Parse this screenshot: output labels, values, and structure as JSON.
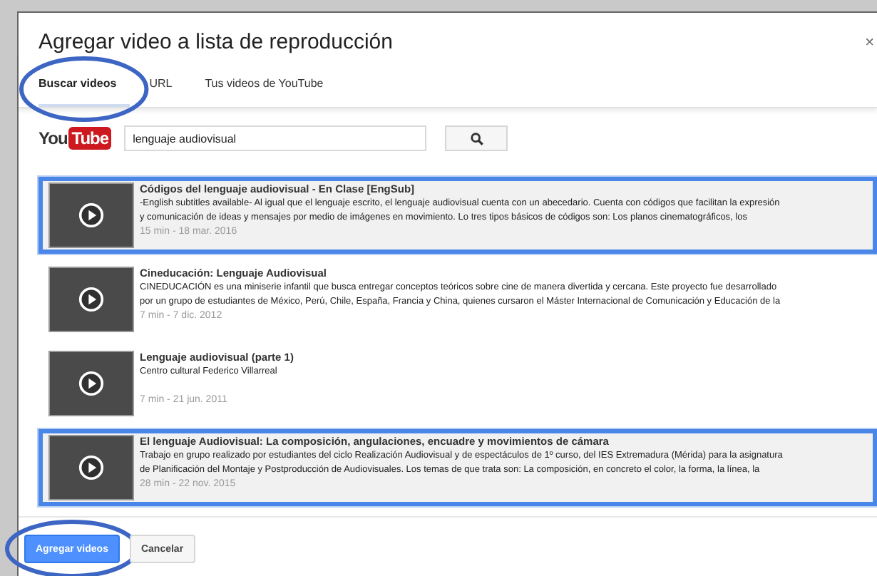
{
  "dialog": {
    "title": "Agregar video a lista de reproducción",
    "close": "×"
  },
  "tabs": [
    {
      "label": "Buscar videos",
      "selected": true,
      "circled": true
    },
    {
      "label": "URL",
      "selected": false,
      "circled": false
    },
    {
      "label": "Tus videos de YouTube",
      "selected": false,
      "circled": false
    }
  ],
  "search": {
    "logo_left": "You",
    "logo_right": "Tube",
    "value": "lenguaje audiovisual"
  },
  "results": [
    {
      "title": "Códigos del lenguaje audiovisual - En Clase [EngSub]",
      "description_lines": [
        "-English subtitles available- Al igual que el lenguaje escrito, el lenguaje audiovisual cuenta con un abecedario. Cuenta con códigos que facilitan la expresión",
        "y comunicación de ideas y mensajes por medio de imágenes en movimiento. Lo tres tipos básicos de códigos son: Los planos cinematográficos, los"
      ],
      "meta": "15 min - 18 mar. 2016",
      "selected": true
    },
    {
      "title": "Cineducación: Lenguaje Audiovisual",
      "description_lines": [
        "CINEDUCACIÓN es una miniserie infantil que busca entregar conceptos teóricos sobre cine de manera divertida y cercana. Este proyecto fue desarrollado",
        "por un grupo de estudiantes de México, Perú, Chile, España, Francia y China, quienes cursaron el Máster Internacional de Comunicación y Educación de la"
      ],
      "meta": "7 min - 7 dic. 2012",
      "selected": false
    },
    {
      "title": "Lenguaje audiovisual (parte 1)",
      "description_lines": [
        "Centro cultural Federico Villarreal"
      ],
      "meta": "7 min - 21 jun. 2011",
      "selected": false
    },
    {
      "title": "El lenguaje Audiovisual: La composición, angulaciones, encuadre y movimientos de cámara",
      "description_lines": [
        "Trabajo en grupo realizado por estudiantes del ciclo Realización Audiovisual y de espectáculos de 1º curso, del IES Extremadura (Mérida) para la asignatura",
        "de Planificación del Montaje y Postproducción de Audiovisuales. Los temas de que trata son: La composición, en concreto el color, la forma, la línea, la"
      ],
      "meta": "28 min - 22 nov. 2015",
      "selected": true
    }
  ],
  "buttons": [
    {
      "label": "Agregar videos",
      "kind": "primary",
      "circled": true
    },
    {
      "label": "Cancelar",
      "kind": "secondary",
      "circled": false
    }
  ]
}
